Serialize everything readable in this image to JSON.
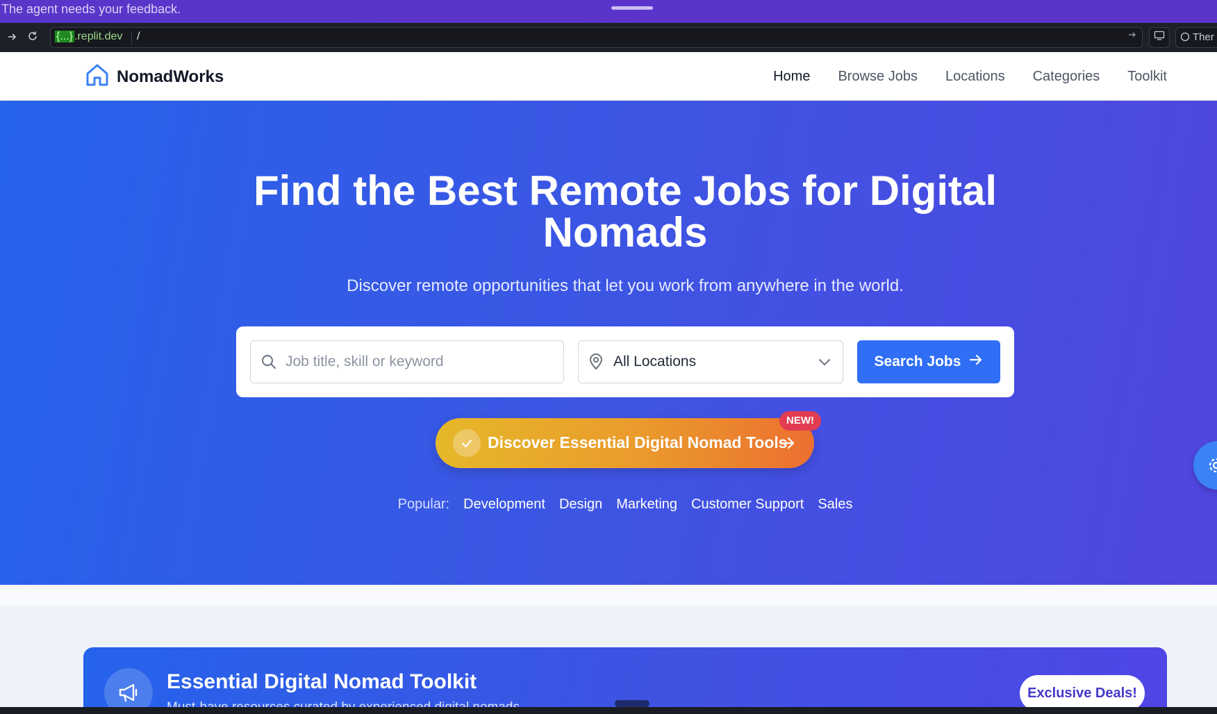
{
  "agent_bar": {
    "message": "The agent needs your feedback."
  },
  "browser": {
    "url_host_highlight": "{...}",
    "url_host_rest": ".replit.dev",
    "url_path": "/",
    "theme_label": "Ther"
  },
  "header": {
    "brand": "NomadWorks",
    "nav": [
      "Home",
      "Browse Jobs",
      "Locations",
      "Categories",
      "Toolkit"
    ],
    "active_nav": "Home"
  },
  "hero": {
    "title_line1": "Find the Best Remote Jobs for Digital",
    "title_line2": "Nomads",
    "subtitle": "Discover remote opportunities that let you work from anywhere in the world.",
    "search": {
      "keyword_placeholder": "Job title, skill or keyword",
      "location_value": "All Locations",
      "button_label": "Search Jobs"
    },
    "tools_button": "Discover Essential Digital Nomad Tools",
    "new_badge": "NEW!",
    "popular_label": "Popular:",
    "popular_tags": [
      "Development",
      "Design",
      "Marketing",
      "Customer Support",
      "Sales"
    ]
  },
  "toolkit": {
    "title": "Essential Digital Nomad Toolkit",
    "subtitle": "Must-have resources curated by experienced digital nomads",
    "deals_button": "Exclusive Deals!"
  },
  "colors": {
    "hero_start": "#2563eb",
    "hero_end": "#5046e0",
    "primary_button": "#2f6ef5",
    "tools_gradient_start": "#e6b82a",
    "tools_gradient_end": "#ec6f30",
    "badge": "#e23c52",
    "agent_bar": "#5a35c9"
  },
  "icons": {
    "brand_icon": "house-icon",
    "search_field_icon": "search-icon",
    "location_icon": "map-pin-icon",
    "location_dropdown_icon": "chevron-down-icon",
    "search_button_icon": "arrow-right-icon",
    "tools_check_icon": "check-icon",
    "tools_arrow_icon": "arrow-right-icon",
    "side_button_icon": "gear-icon",
    "toolkit_icon": "megaphone-icon"
  }
}
